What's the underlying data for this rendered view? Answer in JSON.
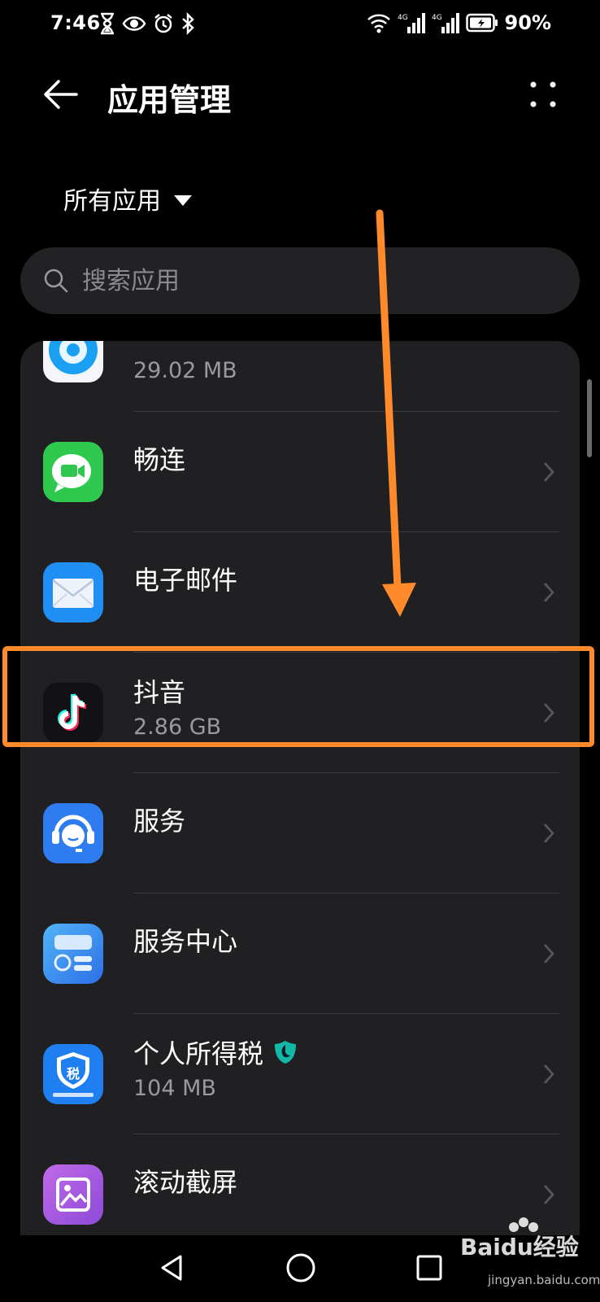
{
  "status_bar": {
    "time": "7:46",
    "battery": "90%",
    "signal_1_label": "4G",
    "signal_2_label": "4G",
    "icons_left": [
      "hourglass-icon",
      "eye-icon",
      "alarm-icon",
      "bluetooth-icon"
    ],
    "icons_right": [
      "wifi-icon",
      "signal-icon",
      "signal-icon",
      "battery-icon"
    ]
  },
  "header": {
    "title": "应用管理"
  },
  "filter": {
    "label": "所有应用"
  },
  "search": {
    "placeholder": "搜索应用"
  },
  "apps": [
    {
      "name": "",
      "size": "29.02 MB",
      "icon": "partial-blue-app-icon"
    },
    {
      "name": "畅连",
      "size": "",
      "icon": "meetime-icon"
    },
    {
      "name": "电子邮件",
      "size": "",
      "icon": "email-icon"
    },
    {
      "name": "抖音",
      "size": "2.86 GB",
      "icon": "douyin-icon"
    },
    {
      "name": "服务",
      "size": "",
      "icon": "service-icon"
    },
    {
      "name": "服务中心",
      "size": "",
      "icon": "service-center-icon"
    },
    {
      "name": "个人所得税",
      "size": "104 MB",
      "icon": "tax-icon"
    },
    {
      "name": "滚动截屏",
      "size": "",
      "icon": "scroll-screenshot-icon"
    }
  ],
  "tax_icon_label": "税",
  "watermark": {
    "brand": "Baidu经验",
    "domain": "jingyan.baidu.com"
  },
  "colors": {
    "background": "#000000",
    "card": "#202022",
    "annotation": "#ff8a2b"
  }
}
